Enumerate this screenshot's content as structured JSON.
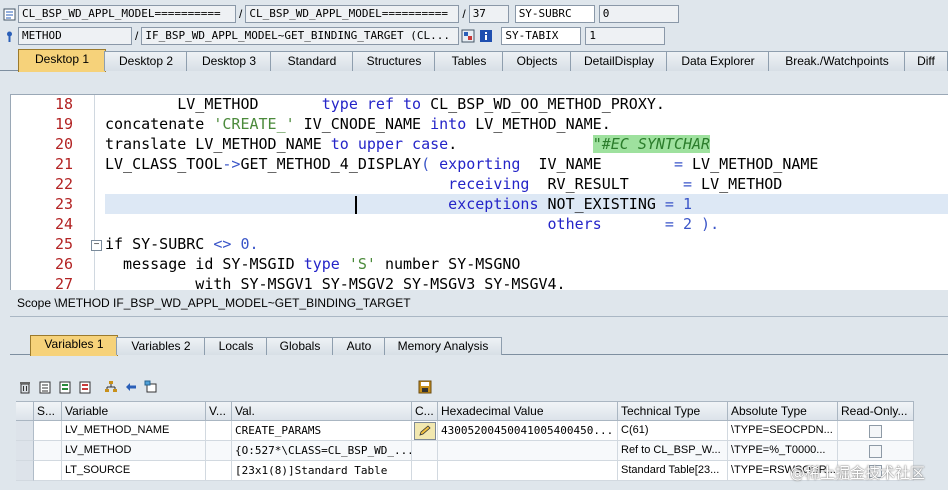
{
  "top": {
    "program": "CL_BSP_WD_APPL_MODEL==========",
    "include": "CL_BSP_WD_APPL_MODEL==========",
    "line": "37",
    "sys1_name": "SY-SUBRC",
    "sys1_value": "0",
    "event_type": "METHOD",
    "event_name": "IF_BSP_WD_APPL_MODEL~GET_BINDING_TARGET (CL...",
    "sys2_name": "SY-TABIX",
    "sys2_value": "1",
    "slash": "/"
  },
  "tabs": [
    "Desktop 1",
    "Desktop 2",
    "Desktop 3",
    "Standard",
    "Structures",
    "Tables",
    "Objects",
    "DetailDisplay",
    "Data Explorer",
    "Break./Watchpoints",
    "Diff"
  ],
  "code": {
    "lines": [
      {
        "n": "18",
        "t": [
          [
            "        LV_METHOD       ",
            ""
          ],
          [
            "type ref to",
            "kw"
          ],
          [
            " CL_BSP_WD_OO_METHOD_PROXY.",
            ""
          ]
        ]
      },
      {
        "n": "19",
        "t": [
          [
            "concatenate",
            ""
          ],
          [
            " 'CREATE_'",
            "str"
          ],
          [
            " IV_CNODE_NAME ",
            ""
          ],
          [
            "into",
            "kw"
          ],
          [
            " LV_METHOD_NAME.",
            ""
          ]
        ]
      },
      {
        "n": "20",
        "t": [
          [
            "translate",
            ""
          ],
          [
            " LV_METHOD_NAME ",
            ""
          ],
          [
            "to upper case",
            "kw"
          ],
          [
            ".               ",
            ""
          ],
          [
            "\"#EC SYNTCHAR",
            "cmt"
          ]
        ]
      },
      {
        "n": "21",
        "t": [
          [
            "LV_CLASS_TOOL",
            ""
          ],
          [
            "->",
            "punc"
          ],
          [
            "GET_METHOD_4_DISPLAY",
            ""
          ],
          [
            "( ",
            "punc"
          ],
          [
            "exporting",
            "kw"
          ],
          [
            "  IV_NAME        ",
            ""
          ],
          [
            "=",
            "punc"
          ],
          [
            " LV_METHOD_NAME",
            ""
          ]
        ]
      },
      {
        "n": "22",
        "t": [
          [
            "                                      ",
            ""
          ],
          [
            "receiving",
            "kw"
          ],
          [
            "  RV_RESULT      ",
            ""
          ],
          [
            "=",
            "punc"
          ],
          [
            " LV_METHOD",
            ""
          ]
        ]
      },
      {
        "n": "23",
        "t": [
          [
            "                                      ",
            ""
          ],
          [
            "exceptions",
            "kw"
          ],
          [
            " NOT_EXISTING ",
            ""
          ],
          [
            "=",
            "punc"
          ],
          [
            " 1",
            "num"
          ]
        ]
      },
      {
        "n": "24",
        "t": [
          [
            "                                                 ",
            ""
          ],
          [
            "others",
            "kw"
          ],
          [
            "       ",
            ""
          ],
          [
            "= 2 ).",
            "num"
          ]
        ]
      },
      {
        "n": "25",
        "t": [
          [
            "if",
            ""
          ],
          [
            " SY-SUBRC ",
            ""
          ],
          [
            "<>",
            "punc"
          ],
          [
            " 0.",
            "num"
          ]
        ]
      },
      {
        "n": "26",
        "t": [
          [
            "  message id",
            ""
          ],
          [
            " SY-MSGID ",
            ""
          ],
          [
            "type",
            "kw"
          ],
          [
            " 'S'",
            "str"
          ],
          [
            " number",
            ""
          ],
          [
            " SY-MSGNO",
            ""
          ]
        ]
      },
      {
        "n": "27",
        "t": [
          [
            "          with",
            ""
          ],
          [
            " SY-MSGV1 SY-MSGV2 SY-MSGV3 SY-MSGV4.",
            ""
          ]
        ]
      }
    ]
  },
  "scope": "Scope \\METHOD IF_BSP_WD_APPL_MODEL~GET_BINDING_TARGET",
  "var_tabs": [
    "Variables 1",
    "Variables 2",
    "Locals",
    "Globals",
    "Auto",
    "Memory Analysis"
  ],
  "table": {
    "headers": [
      "S...",
      "Variable",
      "V...",
      "Val.",
      "C...",
      "Hexadecimal Value",
      "Technical Type",
      "Absolute Type",
      "Read-Only..."
    ],
    "rows": [
      [
        "",
        "LV_METHOD_NAME",
        "",
        "CREATE_PARAMS",
        "",
        "43005200450041005400450...",
        "C(61)",
        "\\TYPE=SEOCPDN...",
        ""
      ],
      [
        "",
        "LV_METHOD",
        "",
        "{O:527*\\CLASS=CL_BSP_WD_...",
        "",
        "",
        "Ref to CL_BSP_W...",
        "\\TYPE=%_T0000...",
        ""
      ],
      [
        "",
        "LT_SOURCE",
        "",
        "[23x1(8)]Standard Table",
        "",
        "",
        "Standard Table[23...",
        "\\TYPE=RSWSOUR...",
        ""
      ]
    ]
  },
  "watermark": "@稀土掘金技术社区"
}
